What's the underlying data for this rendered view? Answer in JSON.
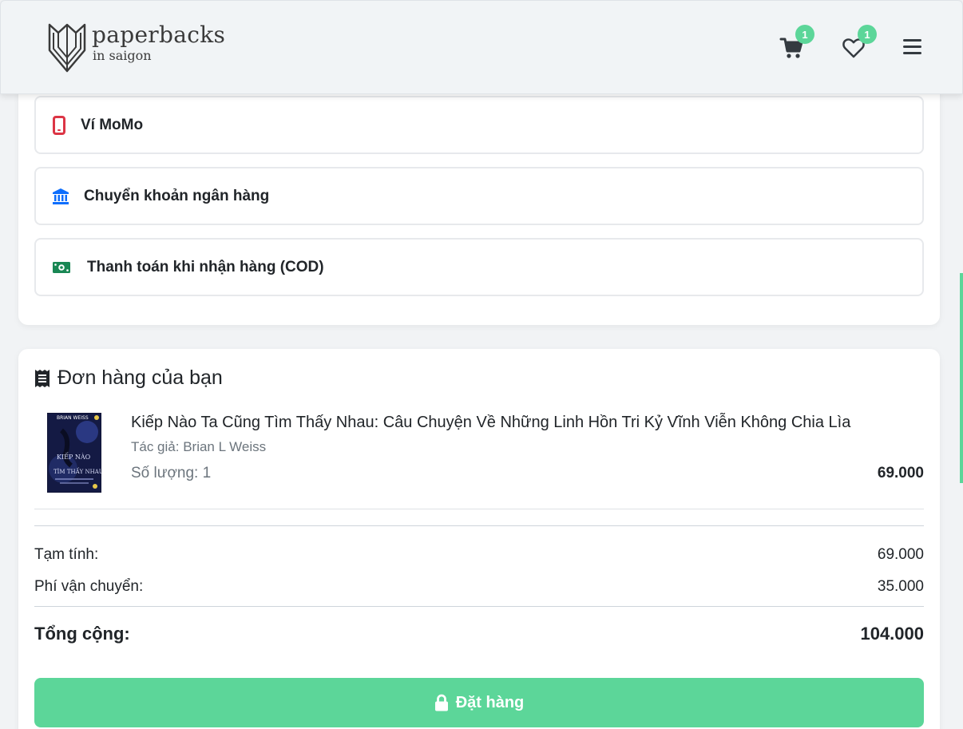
{
  "header": {
    "logo_name": "paperbacks",
    "logo_sub": "in saigon",
    "cart_count": "1",
    "wishlist_count": "1",
    "icons": {
      "cart": "cart-icon",
      "wishlist": "heart-icon",
      "menu": "hamburger-menu-icon"
    }
  },
  "payment": {
    "options": [
      {
        "label": "Ví MoMo",
        "icon": "mobile-phone-icon",
        "icon_color": "#dc3545"
      },
      {
        "label": "Chuyển khoản ngân hàng",
        "icon": "bank-icon",
        "icon_color": "#0d6efd"
      },
      {
        "label": "Thanh toán khi nhận hàng (COD)",
        "icon": "cash-icon",
        "icon_color": "#198754"
      }
    ]
  },
  "order": {
    "title": "Đơn hàng của bạn",
    "item": {
      "title": "Kiếp Nào Ta Cũng Tìm Thấy Nhau: Câu Chuyện Về Những Linh Hồn Tri Kỷ Vĩnh Viễn Không Chia Lìa",
      "author": "Tác giả: Brian L Weiss",
      "quantity": "Số lượng: 1",
      "price": "69.000",
      "cover_author": "BRIAN WEISS",
      "cover_title_1": "KIẾP NÀO",
      "cover_title_2": "TÌM THẤY NHAU"
    },
    "subtotal_label": "Tạm tính:",
    "subtotal": "69.000",
    "shipping_label": "Phí vận chuyển:",
    "shipping": "35.000",
    "total_label": "Tổng cộng:",
    "total": "104.000",
    "button_label": "Đặt hàng"
  },
  "colors": {
    "accent": "#5cd699",
    "momo": "#dc3545",
    "bank": "#0d6efd",
    "cod": "#198754"
  }
}
